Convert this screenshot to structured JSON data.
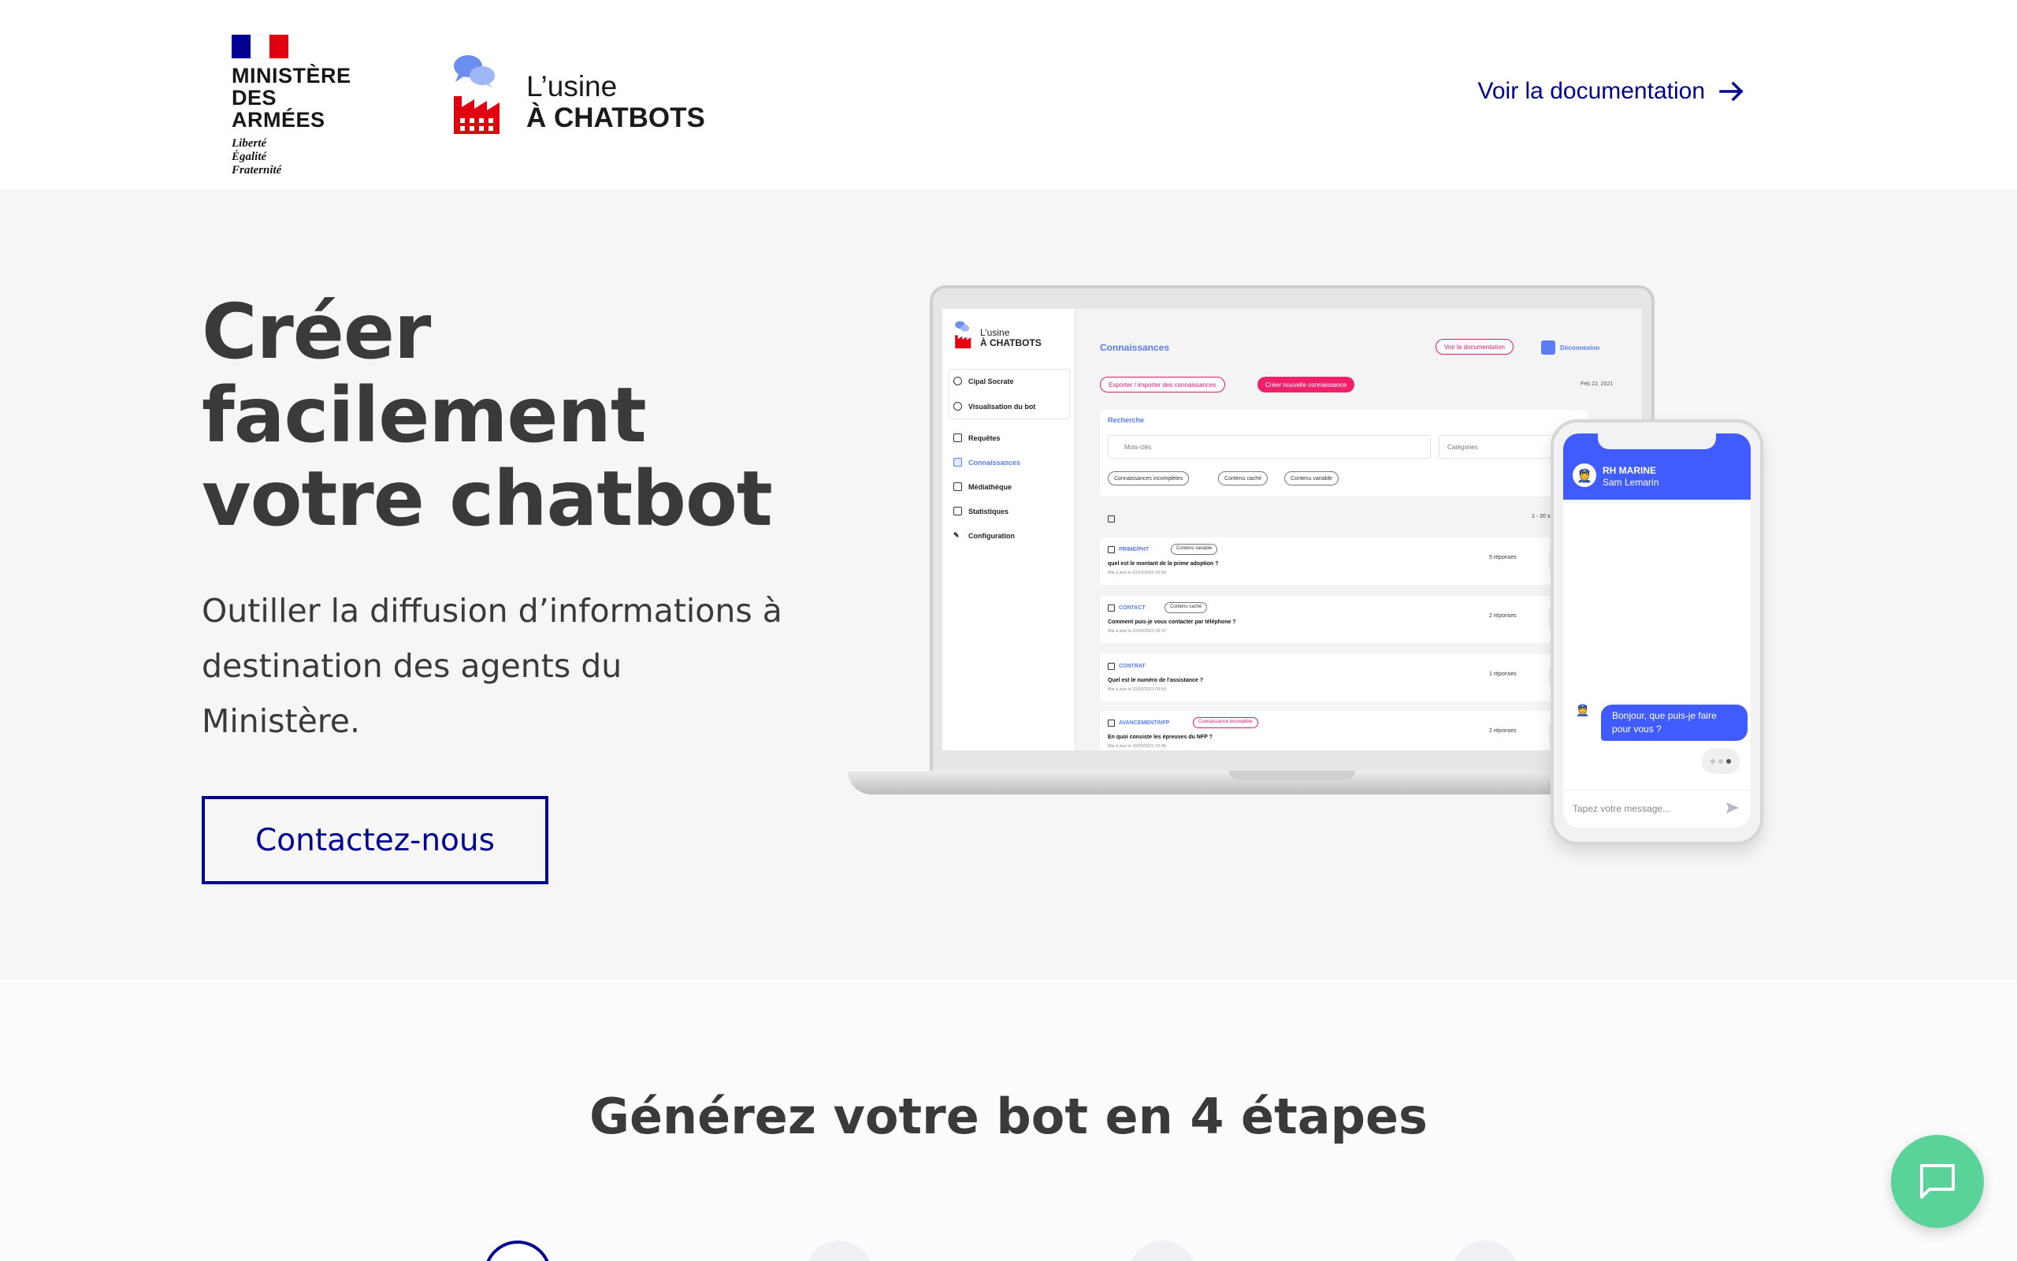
{
  "header": {
    "ministry_line1": "MINISTÈRE",
    "ministry_line2": "DES ARMÉES",
    "motto1": "Liberté",
    "motto2": "Égalité",
    "motto3": "Fraternité",
    "brand_line1": "L’usine",
    "brand_line2": "À CHATBOTS",
    "doc_link": "Voir la documentation",
    "flag_colors": [
      "#000091",
      "#ffffff",
      "#e1000f"
    ]
  },
  "hero": {
    "title_line1": "Créer",
    "title_line2": "facilement",
    "title_line3": "votre chatbot",
    "subtitle": "Outiller la diffusion d’informations à destination des agents du Ministère.",
    "cta": "Contactez-nous"
  },
  "mockup": {
    "sidebar": {
      "logo_l1": "L’usine",
      "logo_l2": "À CHATBOTS",
      "user": "Cipal Socrate",
      "visualisation": "Visualisation du bot",
      "items": [
        "Requêtes",
        "Connaissances",
        "Médiathèque",
        "Statistiques",
        "Configuration"
      ]
    },
    "main": {
      "title": "Connaissances",
      "doc_btn": "Voir la documentation",
      "logout": "Déconnexion",
      "export_btn": "Exporter / importer des connaissances",
      "create_btn": "Créer nouvelle connaissance",
      "date": "Feb 22, 2021",
      "search_label": "Recherche",
      "search_placeholder": "Mots-clés",
      "categories_placeholder": "Catégories",
      "chips": [
        "Connaissances incomplètes",
        "Contenu caché",
        "Contenu variable"
      ],
      "pagination": "1 - 20 sur",
      "rows": [
        {
          "category": "PRIME/PHT",
          "tag": "Contenu variable",
          "question": "quel est le montant de la prime adoption ?",
          "meta": "Mis à jour le 22/12/2020 10:54",
          "count": "5 réponses"
        },
        {
          "category": "CONTACT",
          "tag": "Contenu caché",
          "question": "Comment puis-je vous contacter par téléphone ?",
          "meta": "Mis à jour le 22/02/2021 16:37",
          "count": "2 réponses"
        },
        {
          "category": "CONTRAT",
          "tag": "",
          "question": "Quel est le numéro de l’assistance ?",
          "meta": "Mis à jour le 22/02/2021 09:50",
          "count": "1 réponses"
        },
        {
          "category": "AVANCEMENT/NFP",
          "tag": "Connaissance incomplète",
          "question": "En quoi consiste les épreuves du NFP ?",
          "meta": "Mis à jour le 18/02/2021 10:45",
          "count": "2 réponses"
        }
      ]
    },
    "phone": {
      "bot_name": "RH MARINE",
      "bot_sub": "Sam Lemarin",
      "message": "Bonjour, que puis-je faire pour vous ?",
      "input_placeholder": "Tapez votre message..."
    }
  },
  "steps": {
    "title": "Générez votre bot en 4 étapes",
    "count": 4,
    "active_index": 0
  },
  "colors": {
    "primary": "#000091",
    "accent_blue": "#405bfe",
    "pink": "#f0206b",
    "chat_fab": "#5ad39a"
  }
}
